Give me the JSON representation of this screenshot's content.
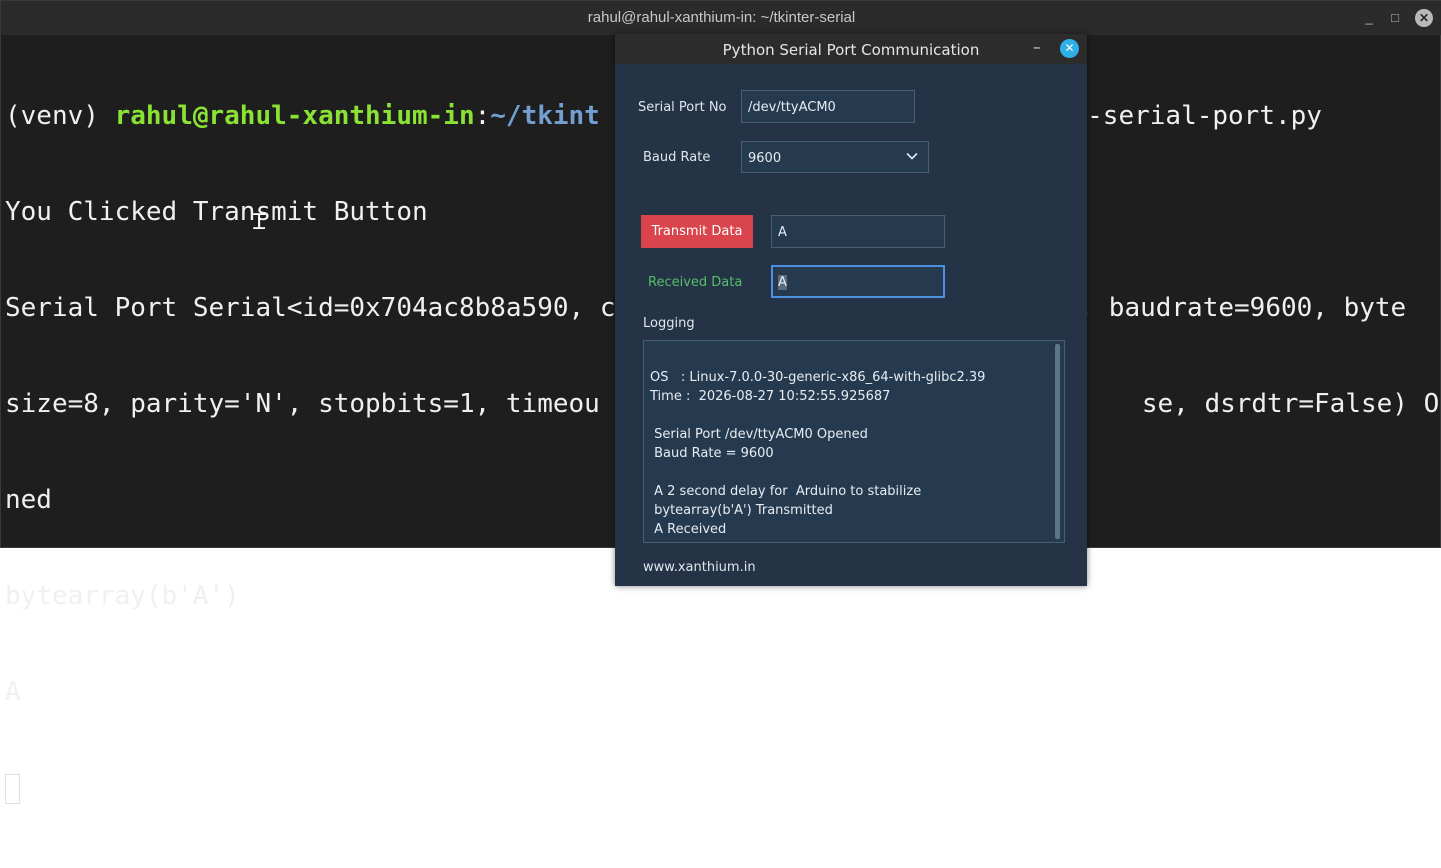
{
  "terminal": {
    "title": "rahul@rahul-xanthium-in: ~/tkinter-serial",
    "window_buttons": {
      "minimize": "_",
      "maximize": "□",
      "close": "✕"
    },
    "line1": {
      "venv": "(venv) ",
      "user_host": "rahul@rahul-xanthium-in",
      "colon": ":",
      "path_visible": "~/tkint",
      "tail_visible": "er-serial-port.py"
    },
    "line2": "You Clicked Transmit Button",
    "line3_left": "Serial Port Serial<id=0x704ac8b8a590, ",
    "line3_left_cut": "c",
    "line3_right": ", baudrate=9600, byte",
    "line4_left": "size=8, parity='N', stopbits=1, timeou",
    "line4_right": "se, dsrdtr=False) Ope",
    "line5": "ned",
    "line6": "bytearray(b'A')",
    "line7": "A"
  },
  "dialog": {
    "title": "Python Serial Port Communication",
    "minimize": "–",
    "close": "✕",
    "serial_port_label": "Serial Port No",
    "serial_port_value": "/dev/ttyACM0",
    "baud_label": "Baud Rate",
    "baud_value": "9600",
    "transmit_button": "Transmit Data",
    "transmit_value": "A",
    "received_label": "Received Data",
    "received_value": "A",
    "logging_label": "Logging",
    "log_lines": [
      "OS   : Linux-7.0.0-30-generic-x86_64-with-glibc2.39",
      "Time :  2026-08-27 10:52:55.925687",
      "",
      " Serial Port /dev/ttyACM0 Opened",
      " Baud Rate = 9600",
      "",
      " A 2 second delay for  Arduino to stabilize",
      " bytearray(b'A') Transmitted",
      " A Received"
    ],
    "footer": "www.xanthium.in",
    "colors": {
      "transmit_button": "#d9444d",
      "received_label": "#55bf6a",
      "close_button": "#2eb0e6",
      "background": "#243446"
    }
  }
}
